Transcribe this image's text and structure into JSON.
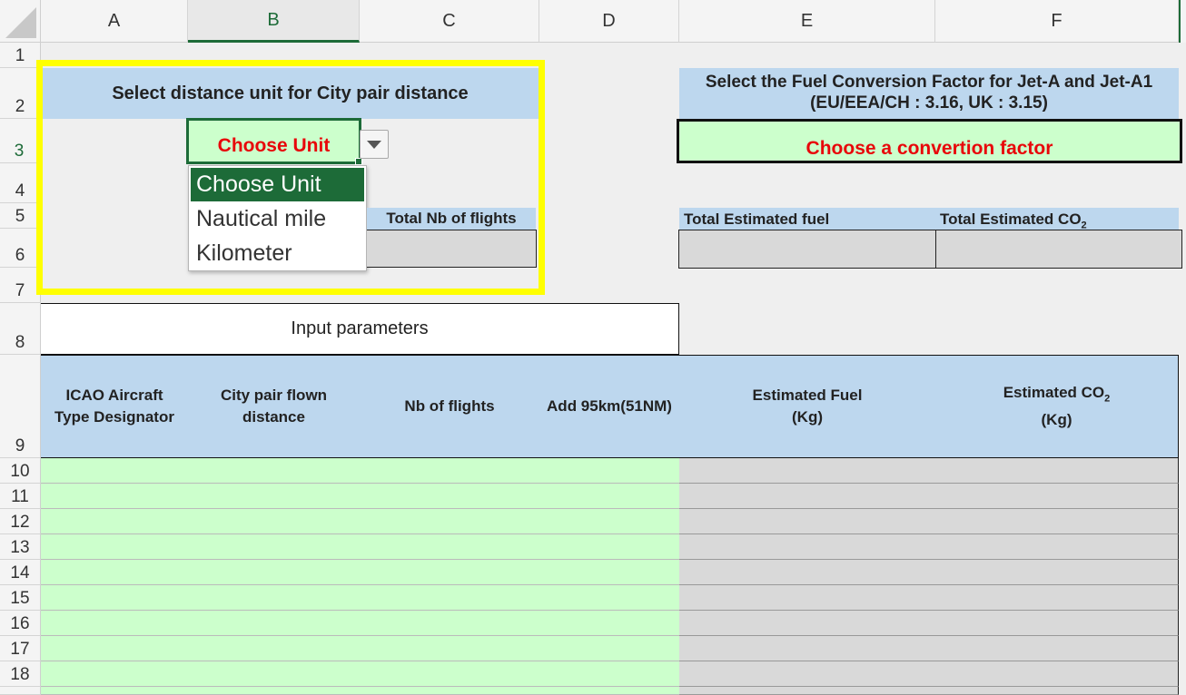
{
  "columns": [
    "A",
    "B",
    "C",
    "D",
    "E",
    "F"
  ],
  "rows": [
    "1",
    "2",
    "3",
    "4",
    "5",
    "6",
    "7",
    "8",
    "9",
    "10",
    "11",
    "12",
    "13",
    "14",
    "15",
    "16",
    "17",
    "18"
  ],
  "distance_unit_prompt": "Select distance unit for City pair distance",
  "unit_cell_value": "Choose Unit",
  "unit_dropdown_options": [
    "Choose Unit",
    "Nautical mile",
    "Kilometer"
  ],
  "conversion_title_line1": "Select the Fuel Conversion Factor for Jet-A and Jet-A1",
  "conversion_title_line2": "(EU/EEA/CH : 3.16, UK : 3.15)",
  "conversion_cell_value": "Choose a convertion factor",
  "total_nb_flights_label": "Total Nb of flights",
  "total_estimated_fuel_label": "Total Estimated fuel",
  "total_estimated_co2_label_main": "Total Estimated CO",
  "total_estimated_co2_label_sub": "2",
  "input_parameters_label": "Input parameters",
  "table_headers": {
    "a1": "ICAO Aircraft",
    "a2": "Type Designator",
    "b1": "City pair flown",
    "b2": "distance",
    "c": "Nb of flights",
    "d": "Add 95km(51NM)",
    "e1": "Estimated Fuel",
    "e2": "(Kg)",
    "f1": "Estimated CO",
    "f1_sub": "2",
    "f2": "(Kg)"
  },
  "colors": {
    "highlight_border": "#ffff00",
    "header_blue": "#bdd7ee",
    "input_green": "#ccffcc",
    "output_gray": "#d9d9d9",
    "selected_green": "#1d6b38",
    "red_text": "#e8060a"
  }
}
